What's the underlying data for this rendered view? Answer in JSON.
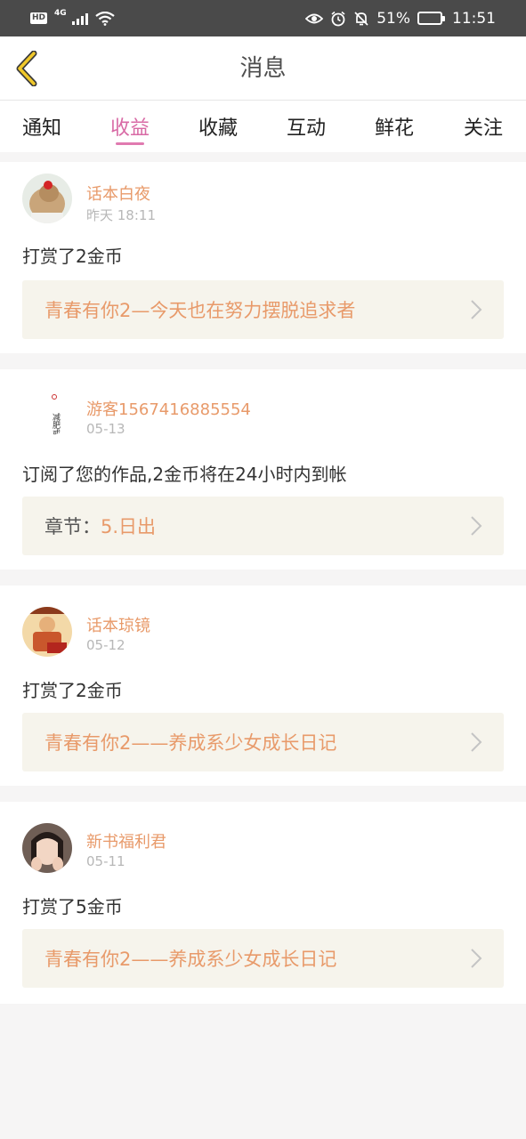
{
  "status_bar": {
    "hd": "HD",
    "network": "4G",
    "battery_percent": "51%",
    "battery_level": 0.51,
    "time": "11:51"
  },
  "header": {
    "title": "消息"
  },
  "tabs": [
    {
      "label": "通知"
    },
    {
      "label": "收益"
    },
    {
      "label": "收藏"
    },
    {
      "label": "互动"
    },
    {
      "label": "鲜花"
    },
    {
      "label": "关注"
    }
  ],
  "active_tab": "收益",
  "messages": [
    {
      "user": "话本白夜",
      "time": "昨天 18:11",
      "text": "打赏了2金币",
      "ref_prefix": "",
      "ref_title": "青春有你2—今天也在努力摆脱追求者"
    },
    {
      "user": "游客1567416885554",
      "time": "05-13",
      "text": "订阅了您的作品,2金币将在24小时内到帐",
      "ref_prefix": "章节：",
      "ref_title": "5.日出",
      "avatar_text": "减肥或者去死"
    },
    {
      "user": "话本琼镜",
      "time": "05-12",
      "text": "打赏了2金币",
      "ref_prefix": "",
      "ref_title": "青春有你2——养成系少女成长日记"
    },
    {
      "user": "新书福利君",
      "time": "05-11",
      "text": "打赏了5金币",
      "ref_prefix": "",
      "ref_title": "青春有你2——养成系少女成长日记"
    }
  ],
  "colors": {
    "accent_pink": "#d86aa5",
    "name_orange": "#e89a6a",
    "back_arrow_yellow": "#f0c82a"
  }
}
